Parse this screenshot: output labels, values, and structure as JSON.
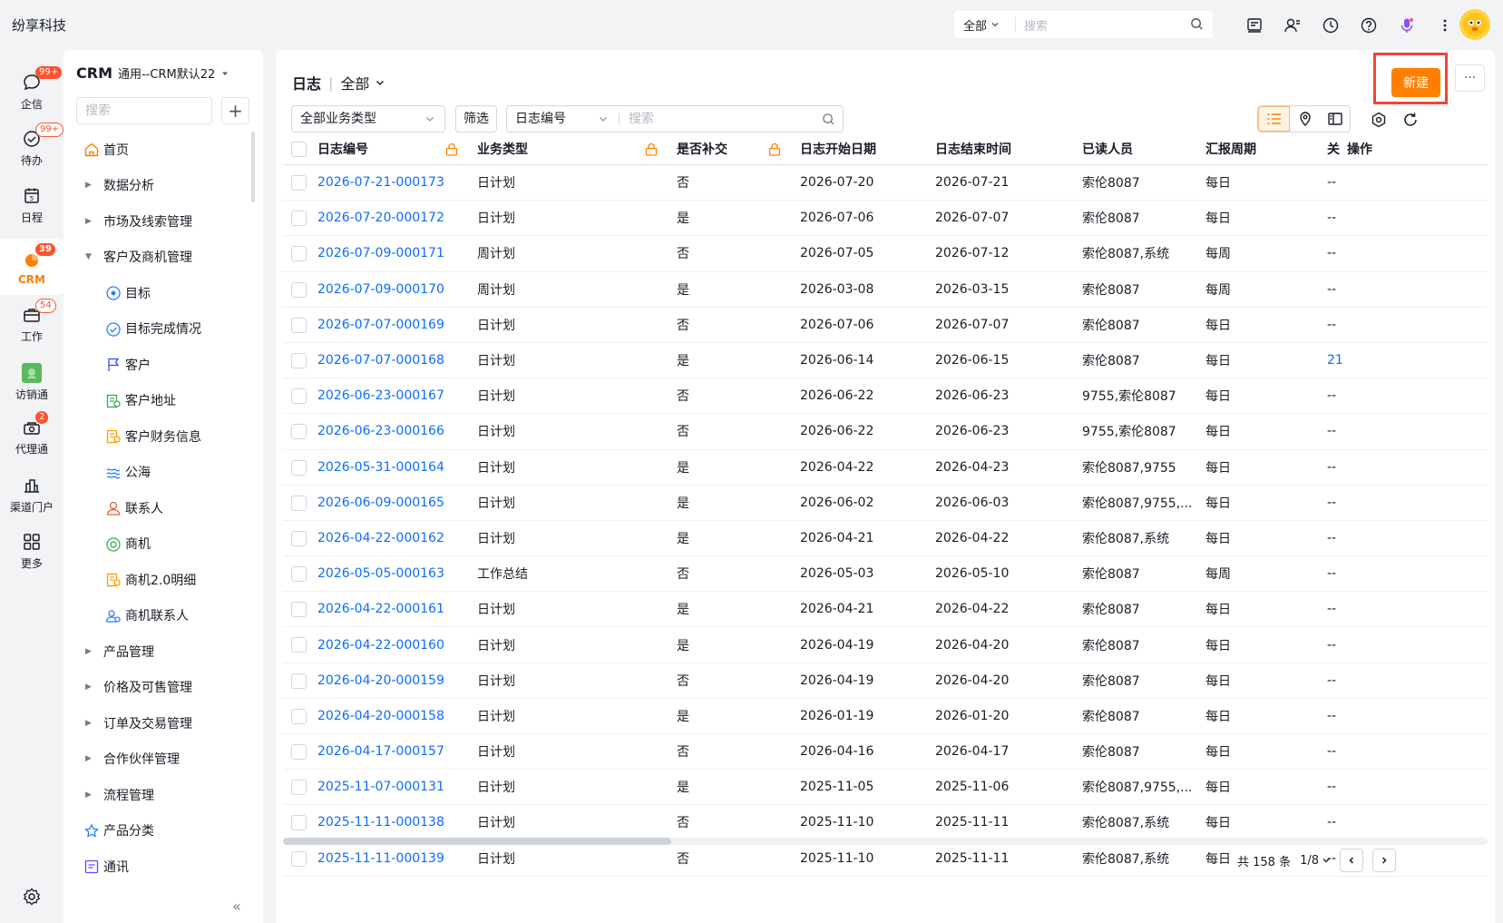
{
  "app": {
    "brand": "纷享科技"
  },
  "search": {
    "scope": "全部",
    "placeholder": "搜索"
  },
  "leftnav": [
    {
      "label": "企信",
      "badge": "99+",
      "icon": "chat-icon"
    },
    {
      "label": "待办",
      "badge": "99+",
      "icon": "todo-icon"
    },
    {
      "label": "日程",
      "badge": "",
      "icon": "calendar-icon"
    },
    {
      "label": "CRM",
      "badge": "39",
      "icon": "crm-icon"
    },
    {
      "label": "工作",
      "badge": "54",
      "icon": "briefcase-icon"
    },
    {
      "label": "访销通",
      "badge": "",
      "icon": "visit-icon"
    },
    {
      "label": "代理通",
      "badge": "2",
      "icon": "agent-icon"
    },
    {
      "label": "渠道门户",
      "badge": "",
      "icon": "portal-icon"
    },
    {
      "label": "更多",
      "badge": "",
      "icon": "grid-icon"
    }
  ],
  "sidebar": {
    "title": "CRM",
    "subtitle": "通用--CRM默认22",
    "search_placeholder": "搜索",
    "items": [
      {
        "label": "首页",
        "type": "icon"
      },
      {
        "label": "数据分析",
        "type": "collapsed"
      },
      {
        "label": "市场及线索管理",
        "type": "collapsed"
      },
      {
        "label": "客户及商机管理",
        "type": "expanded"
      },
      {
        "label": "目标",
        "type": "sub"
      },
      {
        "label": "目标完成情况",
        "type": "sub"
      },
      {
        "label": "客户",
        "type": "sub"
      },
      {
        "label": "客户地址",
        "type": "sub"
      },
      {
        "label": "客户财务信息",
        "type": "sub"
      },
      {
        "label": "公海",
        "type": "sub"
      },
      {
        "label": "联系人",
        "type": "sub"
      },
      {
        "label": "商机",
        "type": "sub"
      },
      {
        "label": "商机2.0明细",
        "type": "sub"
      },
      {
        "label": "商机联系人",
        "type": "sub"
      },
      {
        "label": "产品管理",
        "type": "collapsed"
      },
      {
        "label": "价格及可售管理",
        "type": "collapsed"
      },
      {
        "label": "订单及交易管理",
        "type": "collapsed"
      },
      {
        "label": "合作伙伴管理",
        "type": "collapsed"
      },
      {
        "label": "流程管理",
        "type": "collapsed"
      },
      {
        "label": "产品分类",
        "type": "icon"
      },
      {
        "label": "通讯",
        "type": "icon"
      }
    ]
  },
  "main": {
    "title": "日志",
    "scope": "全部",
    "new_label": "新建",
    "more_label": "···",
    "filter_type": "全部业务类型",
    "filter_btn": "筛选",
    "search_field": "日志编号",
    "search_placeholder": "搜索",
    "columns": [
      "日志编号",
      "业务类型",
      "是否补交",
      "日志开始日期",
      "日志结束时间",
      "已读人员",
      "汇报周期",
      "关",
      "操作"
    ],
    "rows": [
      [
        "2026-07-21-000173",
        "日计划",
        "否",
        "2026-07-20",
        "2026-07-21",
        "索伦8087",
        "每日",
        "--"
      ],
      [
        "2026-07-20-000172",
        "日计划",
        "是",
        "2026-07-06",
        "2026-07-07",
        "索伦8087",
        "每日",
        "--"
      ],
      [
        "2026-07-09-000171",
        "周计划",
        "否",
        "2026-07-05",
        "2026-07-12",
        "索伦8087,系统",
        "每周",
        "--"
      ],
      [
        "2026-07-09-000170",
        "周计划",
        "是",
        "2026-03-08",
        "2026-03-15",
        "索伦8087",
        "每周",
        "--"
      ],
      [
        "2026-07-07-000169",
        "日计划",
        "否",
        "2026-07-06",
        "2026-07-07",
        "索伦8087",
        "每日",
        "--"
      ],
      [
        "2026-07-07-000168",
        "日计划",
        "是",
        "2026-06-14",
        "2026-06-15",
        "索伦8087",
        "每日",
        "21"
      ],
      [
        "2026-06-23-000167",
        "日计划",
        "否",
        "2026-06-22",
        "2026-06-23",
        "9755,索伦8087",
        "每日",
        "--"
      ],
      [
        "2026-06-23-000166",
        "日计划",
        "否",
        "2026-06-22",
        "2026-06-23",
        "9755,索伦8087",
        "每日",
        "--"
      ],
      [
        "2026-05-31-000164",
        "日计划",
        "是",
        "2026-04-22",
        "2026-04-23",
        "索伦8087,9755",
        "每日",
        "--"
      ],
      [
        "2026-06-09-000165",
        "日计划",
        "是",
        "2026-06-02",
        "2026-06-03",
        "索伦8087,9755,...",
        "每日",
        "--"
      ],
      [
        "2026-04-22-000162",
        "日计划",
        "是",
        "2026-04-21",
        "2026-04-22",
        "索伦8087,系统",
        "每日",
        "--"
      ],
      [
        "2026-05-05-000163",
        "工作总结",
        "否",
        "2026-05-03",
        "2026-05-10",
        "索伦8087",
        "每周",
        "--"
      ],
      [
        "2026-04-22-000161",
        "日计划",
        "是",
        "2026-04-21",
        "2026-04-22",
        "索伦8087",
        "每日",
        "--"
      ],
      [
        "2026-04-22-000160",
        "日计划",
        "是",
        "2026-04-19",
        "2026-04-20",
        "索伦8087",
        "每日",
        "--"
      ],
      [
        "2026-04-20-000159",
        "日计划",
        "否",
        "2026-04-19",
        "2026-04-20",
        "索伦8087",
        "每日",
        "--"
      ],
      [
        "2026-04-20-000158",
        "日计划",
        "是",
        "2026-01-19",
        "2026-01-20",
        "索伦8087",
        "每日",
        "--"
      ],
      [
        "2026-04-17-000157",
        "日计划",
        "否",
        "2026-04-16",
        "2026-04-17",
        "索伦8087",
        "每日",
        "--"
      ],
      [
        "2025-11-07-000131",
        "日计划",
        "是",
        "2025-11-05",
        "2025-11-06",
        "索伦8087,9755,...",
        "每日",
        "--"
      ],
      [
        "2025-11-11-000138",
        "日计划",
        "否",
        "2025-11-10",
        "2025-11-11",
        "索伦8087,系统",
        "每日",
        "--"
      ],
      [
        "2025-11-11-000139",
        "日计划",
        "否",
        "2025-11-10",
        "2025-11-11",
        "索伦8087,系统",
        "每日",
        "--"
      ]
    ],
    "pager": {
      "total": "共 158 条",
      "page": "1/8"
    }
  },
  "colors": {
    "accent": "#ff8000",
    "link": "#0c6cff",
    "highlight": "#f44336"
  }
}
